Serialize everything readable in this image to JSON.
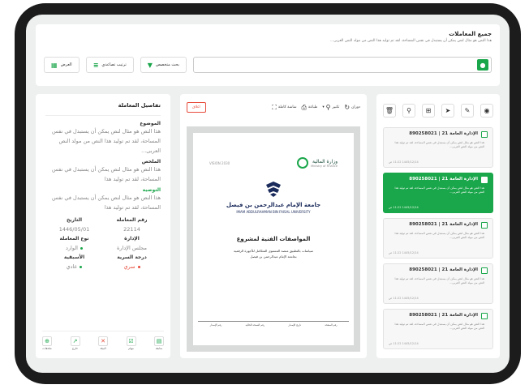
{
  "header": {
    "title": "جميع المعاملات",
    "subtitle": "هذا النص هو مثال لنص يمكن أن يستبدل في نفس المساحة، لقد تم توليد هذا النص من مولد النص العربى...",
    "advanced_search": "بحث متخصص",
    "sort_label": "ترتيب تصاعدي",
    "view_label": "العرض"
  },
  "toolbar_icons": [
    "trash-icon",
    "search-icon",
    "org-icon",
    "send-icon",
    "edit-icon",
    "eye-icon"
  ],
  "list": {
    "items": [
      {
        "title": "الإدارة العامة 21 | 890258021",
        "desc": "هذا النص هو مثال لنص يمكن أن يستبدل في نفس المساحة، لقد تم توليد هذا النص من مولد النص العربى...",
        "date": "1445/12/14 11:22 ص",
        "selected": false
      },
      {
        "title": "الإدارة العامة 21 | 890258021",
        "desc": "هذا النص هو مثال لنص يمكن أن يستبدل في نفس المساحة، لقد تم توليد هذا النص من مولد النص العربى...",
        "date": "1445/12/14 11:22 ص",
        "selected": true
      },
      {
        "title": "الإدارة العامة 21 | 890258021",
        "desc": "هذا النص هو مثال لنص يمكن أن يستبدل في نفس المساحة، لقد تم توليد هذا النص من مولد النص العربى...",
        "date": "1445/12/14 11:22 ص",
        "selected": false
      },
      {
        "title": "الإدارة العامة 21 | 890258021",
        "desc": "هذا النص هو مثال لنص يمكن أن يستبدل في نفس المساحة، لقد تم توليد هذا النص من مولد النص العربى...",
        "date": "1445/12/14 11:22 ص",
        "selected": false
      },
      {
        "title": "الإدارة العامة 21 | 890258021",
        "desc": "هذا النص هو مثال لنص يمكن أن يستبدل في نفس المساحة، لقد تم توليد هذا النص من مولد النص العربى...",
        "date": "1445/12/14 11:22 ص",
        "selected": false
      }
    ]
  },
  "viewer": {
    "rotate": "دوران",
    "zoom": "تكبير",
    "print": "طباعة",
    "fullscreen": "شاشة كاملة",
    "close": "اغلاق"
  },
  "document": {
    "mof_name": "وزارة المالية",
    "mof_en": "Ministry of Finance",
    "vision": "VISION 2030",
    "uni_ar": "جامعة الإمام عبدالرحمن بن فيصل",
    "uni_en": "IMAM ABDULRAHMAN BIN FAISAL UNIVERSITY",
    "title": "المواصفات الفنية لمشروع",
    "line1": "سياسات بالتطبيق منصة المستوى المتكامل للأجهزة الرقمية",
    "line2": "بجامعة الإمام عبدالرحمن بن فيصل",
    "footer": [
      "رقم الصفحة",
      "تاريخ الإصدار",
      "رقم النسخة الحالية",
      "رقم الإصدار"
    ]
  },
  "details": {
    "heading": "تفاصيل المعاملة",
    "subject_label": "الموضوع",
    "subject_text": "هذا النص هو مثال لنص يمكن أن يستبدل في نفس المساحة، لقد تم توليد هذا النص من مولد النص العربى...",
    "summary_label": "الملخص",
    "summary_text": "هذا النص هو مثال لنص يمكن أن يستبدل في نفس المساحة، لقد تم توليد هذا",
    "recommendation_label": "التوصية",
    "recommendation_text": "هذا النص هو مثال لنص يمكن أن يستبدل في نفس المساحة، لقد تم توليد هذا",
    "txn_no_label": "رقم المعاملة",
    "txn_no": "22114",
    "date_label": "التاريخ",
    "date": "1446/05/01",
    "dept_label": "الإدارة",
    "dept": "مجلس الإدارة",
    "type_label": "نوع المعاملة",
    "type": "الوارد",
    "secrecy_label": "درجة السرية",
    "secrecy": "سري",
    "priority_label": "الأسبقية",
    "priority": "عادي",
    "actions": [
      "متابعة",
      "مهام",
      "البيئة",
      "خارج",
      "ملحقات"
    ]
  },
  "colors": {
    "accent": "#1aa64a",
    "danger": "#e74c3c"
  }
}
